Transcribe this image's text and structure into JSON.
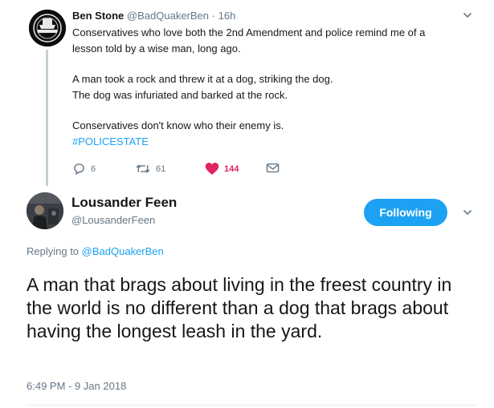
{
  "tweet1": {
    "name": "Ben Stone",
    "handle": "@BadQuakerBen",
    "separator": "·",
    "time": "16h",
    "lines": [
      "Conservatives who love both the 2nd Amendment and police remind me of a",
      "lesson told by a wise man, long ago.",
      "A man took a rock and threw it at a dog, striking the dog.",
      "The dog was infuriated and barked at the rock.",
      "Conservatives don't know who their enemy is."
    ],
    "hashtag": "#POLICESTATE",
    "reply_count": "6",
    "retweet_count": "61",
    "like_count": "144",
    "like_color": "#e0245e"
  },
  "tweet2": {
    "name": "Lousander Feen",
    "handle": "@LousanderFeen",
    "follow_label": "Following",
    "replying_prefix": "Replying to",
    "replying_to": "@BadQuakerBen",
    "body": "A man that brags about living in the freest country in the world is no different than a dog that brags about having the longest leash in the yard.",
    "timestamp": "6:49 PM - 9 Jan 2018"
  },
  "colors": {
    "accent": "#1da1f2",
    "muted": "#657786",
    "text": "#14171a"
  },
  "icons": {
    "reply": "reply-icon",
    "retweet": "retweet-icon",
    "like": "heart-icon",
    "dm": "envelope-icon",
    "caret": "chevron-down-icon"
  }
}
